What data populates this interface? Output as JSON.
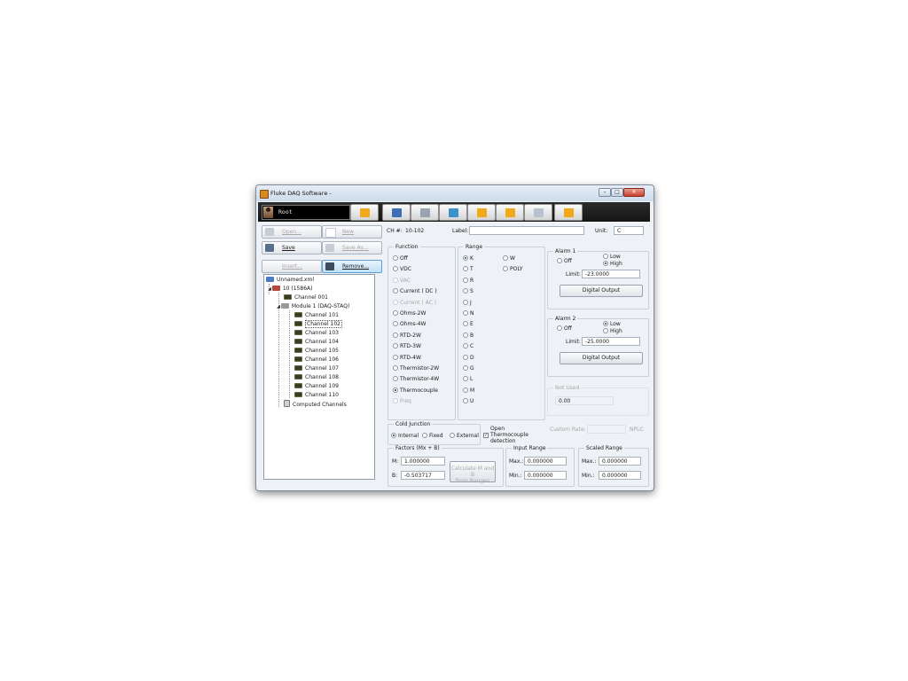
{
  "window": {
    "title": "Fluke DAQ Software -"
  },
  "toolbar": {
    "user": "Root",
    "buttons": [
      {
        "name": "lock-icon",
        "color": "#f0a91b"
      },
      {
        "name": "user-icon",
        "color": "#3e6fb4"
      },
      {
        "name": "list-icon",
        "color": "#9aa4b0"
      },
      {
        "name": "network-icon",
        "color": "#3b93c9"
      },
      {
        "name": "chart-icon",
        "color": "#f0a91b"
      },
      {
        "name": "config-icon",
        "color": "#f0a91b"
      },
      {
        "name": "email-icon",
        "color": "#b8c2cf"
      },
      {
        "name": "close-app-icon",
        "color": "#f0a91b"
      }
    ]
  },
  "file_buttons": {
    "open": "Open...",
    "new": "New",
    "save": "Save",
    "save_as": "Save As...",
    "insert": "Insert...",
    "remove": "Remove..."
  },
  "tree": {
    "root": "Unnamed.xml",
    "device": "10 (1586A)",
    "channel001": "Channel 001",
    "module": "Module 1 (DAQ-STAQ)",
    "channels": [
      "Channel 101",
      "Channel 102",
      "Channel 103",
      "Channel 104",
      "Channel 105",
      "Channel 106",
      "Channel 107",
      "Channel 108",
      "Channel 109",
      "Channel 110"
    ],
    "computed": "Computed Channels"
  },
  "header": {
    "ch_label": "CH #:",
    "ch_value": "10-102",
    "label_label": "Label:",
    "label_value": "",
    "unit_label": "Unit:",
    "unit_value": "C"
  },
  "function": {
    "title": "Function",
    "options": [
      "Off",
      "VDC",
      "VAC",
      "Current ( DC )",
      "Current ( AC )",
      "Ohms-2W",
      "Ohms-4W",
      "RTD-2W",
      "RTD-3W",
      "RTD-4W",
      "Thermistor-2W",
      "Thermistor-4W",
      "Thermocouple",
      "Freq"
    ],
    "selected": "Thermocouple"
  },
  "range": {
    "title": "Range",
    "col1": [
      "K",
      "T",
      "R",
      "S",
      "J",
      "N",
      "E",
      "B",
      "C",
      "D",
      "G",
      "L",
      "M",
      "U"
    ],
    "col2": [
      "W",
      "POLY"
    ],
    "selected": "K"
  },
  "alarm1": {
    "title": "Alarm 1",
    "off": "Off",
    "low": "Low",
    "high": "High",
    "selected": "High",
    "limit_label": "Limit:",
    "limit_value": "-23.0000",
    "button": "Digital Output"
  },
  "alarm2": {
    "title": "Alarm 2",
    "off": "Off",
    "low": "Low",
    "high": "High",
    "selected": "Low",
    "limit_label": "Limit:",
    "limit_value": "-25.0000",
    "button": "Digital Output"
  },
  "not_used": {
    "title": "Not Used",
    "value": "0.00"
  },
  "custom_rate": {
    "label": "Custom Rate:",
    "unit": "NPLC"
  },
  "cold_junction": {
    "title": "Cold Junction",
    "options": [
      "Internal",
      "Fixed",
      "External"
    ],
    "selected": "Internal"
  },
  "open_tc": {
    "label_line1": "Open",
    "label_line2": "Thermocouple",
    "label_line3": "detection",
    "checked": true
  },
  "factors": {
    "title": "Factors (Mx + B)",
    "m_label": "M:",
    "m_value": "1.000000",
    "b_label": "B:",
    "b_value": "-0.503717",
    "calc_line1": "Calculate M and B",
    "calc_line2": "from Ranges"
  },
  "input_range": {
    "title": "Input Range",
    "max_label": "Max.:",
    "max_value": "0.000000",
    "min_label": "Min.:",
    "min_value": "0.000000"
  },
  "scaled_range": {
    "title": "Scaled Range",
    "max_label": "Max.:",
    "max_value": "0.000000",
    "min_label": "Min.:",
    "min_value": "0.000000"
  }
}
